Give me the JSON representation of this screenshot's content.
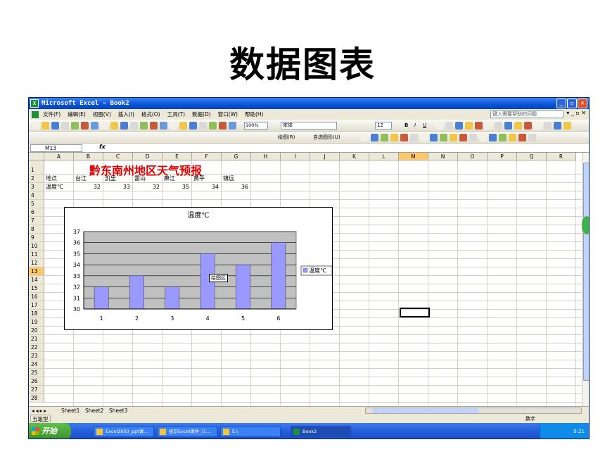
{
  "slide": {
    "title": "数据图表"
  },
  "window": {
    "title": "Microsoft Excel - Book2"
  },
  "menu": [
    "文件(F)",
    "编辑(E)",
    "视图(V)",
    "插入(I)",
    "格式(O)",
    "工具(T)",
    "数据(D)",
    "窗口(W)",
    "帮助(H)"
  ],
  "help_placeholder": "键入需要帮助的问题",
  "toolbar": {
    "zoom": "100%",
    "font": "宋体",
    "size": "12",
    "drawing_label": "绘图(R)",
    "autoshape_label": "自选图形(U)"
  },
  "formula_bar": {
    "name_box": "M13",
    "fx": "fx"
  },
  "columns": [
    "A",
    "B",
    "C",
    "D",
    "E",
    "F",
    "G",
    "H",
    "I",
    "J",
    "K",
    "L",
    "M",
    "N",
    "O",
    "P",
    "Q",
    "R"
  ],
  "rows": [
    "1",
    "2",
    "3",
    "4",
    "5",
    "6",
    "7",
    "8",
    "9",
    "10",
    "11",
    "12",
    "13",
    "14",
    "15",
    "16",
    "17",
    "18",
    "19",
    "20",
    "21",
    "22",
    "23",
    "24",
    "25",
    "26",
    "27",
    "28"
  ],
  "sheet": {
    "heading": "黔东南州地区天气预报",
    "row2": [
      "地点",
      "台江",
      "凯里",
      "雷山",
      "麻江",
      "黄平",
      "镇远"
    ],
    "row3": [
      "温度℃",
      "32",
      "33",
      "32",
      "35",
      "34",
      "36"
    ]
  },
  "chart_data": {
    "type": "bar",
    "title": "温度℃",
    "categories": [
      "1",
      "2",
      "3",
      "4",
      "5",
      "6"
    ],
    "series": [
      {
        "name": "温度℃",
        "values": [
          32,
          33,
          32,
          35,
          34,
          36
        ]
      }
    ],
    "ylim": [
      30,
      37
    ],
    "yticks": [
      "30",
      "31",
      "32",
      "33",
      "34",
      "35",
      "36",
      "37"
    ],
    "grid": true,
    "legend": "right",
    "plot_area_tooltip": "绘图区",
    "colors": {
      "bar": "#9999ff",
      "plot_bg": "#c0c0c0"
    }
  },
  "sheet_tabs": [
    "Sheet1",
    "Sheet2",
    "Sheet3"
  ],
  "ime_label": "五笔型",
  "status": {
    "mode": "数字"
  },
  "taskbar": {
    "start": "开始",
    "tasks": [
      "Excel2003_ppt课...",
      "初识Excel课件_(1...",
      "E:\\",
      "Book2"
    ],
    "clock": "9:21"
  }
}
